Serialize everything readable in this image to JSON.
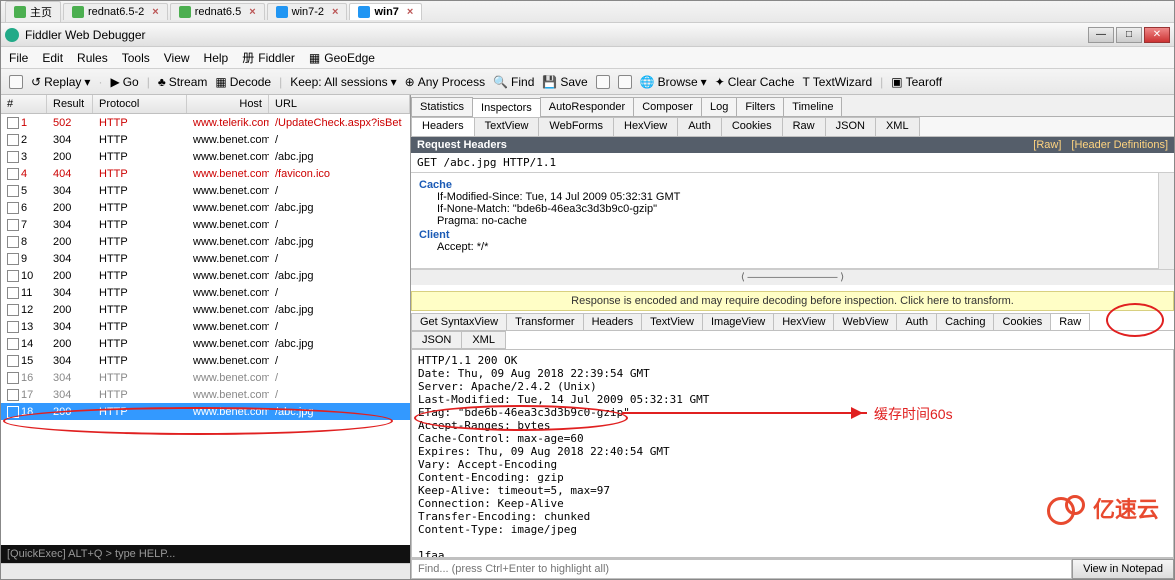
{
  "ext_tabs": [
    {
      "label": "主页",
      "icon": "home"
    },
    {
      "label": "rednat6.5-2",
      "icon": "green",
      "close": true
    },
    {
      "label": "rednat6.5",
      "icon": "green",
      "close": true
    },
    {
      "label": "win7-2",
      "icon": "blue",
      "close": true
    },
    {
      "label": "win7",
      "icon": "blue",
      "close": true,
      "active": true
    }
  ],
  "app_title": "Fiddler Web Debugger",
  "menus": [
    "File",
    "Edit",
    "Rules",
    "Tools",
    "View",
    "Help"
  ],
  "menu_fiddler": "Fiddler",
  "menu_geoedge": "GeoEdge",
  "toolbar": {
    "replay": "Replay",
    "go": "Go",
    "stream": "Stream",
    "decode": "Decode",
    "keep": "Keep: All sessions",
    "any": "Any Process",
    "find": "Find",
    "save": "Save",
    "browse": "Browse",
    "clear": "Clear Cache",
    "tw": "TextWizard",
    "tear": "Tearoff"
  },
  "cols": {
    "id": "#",
    "result": "Result",
    "protocol": "Protocol",
    "host": "Host",
    "url": "URL"
  },
  "rows": [
    {
      "n": "1",
      "res": "502",
      "proto": "HTTP",
      "host": "www.telerik.com",
      "url": "/UpdateCheck.aspx?isBet",
      "cls": "red",
      "ico": "err"
    },
    {
      "n": "2",
      "res": "304",
      "proto": "HTTP",
      "host": "www.benet.com",
      "url": "/",
      "cls": "",
      "ico": "doc"
    },
    {
      "n": "3",
      "res": "200",
      "proto": "HTTP",
      "host": "www.benet.com",
      "url": "/abc.jpg",
      "cls": "",
      "ico": "img"
    },
    {
      "n": "4",
      "res": "404",
      "proto": "HTTP",
      "host": "www.benet.com",
      "url": "/favicon.ico",
      "cls": "red",
      "ico": "warn"
    },
    {
      "n": "5",
      "res": "304",
      "proto": "HTTP",
      "host": "www.benet.com",
      "url": "/",
      "cls": "",
      "ico": "doc"
    },
    {
      "n": "6",
      "res": "200",
      "proto": "HTTP",
      "host": "www.benet.com",
      "url": "/abc.jpg",
      "cls": "",
      "ico": "img"
    },
    {
      "n": "7",
      "res": "304",
      "proto": "HTTP",
      "host": "www.benet.com",
      "url": "/",
      "cls": "",
      "ico": "doc"
    },
    {
      "n": "8",
      "res": "200",
      "proto": "HTTP",
      "host": "www.benet.com",
      "url": "/abc.jpg",
      "cls": "",
      "ico": "img"
    },
    {
      "n": "9",
      "res": "304",
      "proto": "HTTP",
      "host": "www.benet.com",
      "url": "/",
      "cls": "",
      "ico": "doc"
    },
    {
      "n": "10",
      "res": "200",
      "proto": "HTTP",
      "host": "www.benet.com",
      "url": "/abc.jpg",
      "cls": "",
      "ico": "img"
    },
    {
      "n": "11",
      "res": "304",
      "proto": "HTTP",
      "host": "www.benet.com",
      "url": "/",
      "cls": "",
      "ico": "doc"
    },
    {
      "n": "12",
      "res": "200",
      "proto": "HTTP",
      "host": "www.benet.com",
      "url": "/abc.jpg",
      "cls": "",
      "ico": "img"
    },
    {
      "n": "13",
      "res": "304",
      "proto": "HTTP",
      "host": "www.benet.com",
      "url": "/",
      "cls": "",
      "ico": "doc"
    },
    {
      "n": "14",
      "res": "200",
      "proto": "HTTP",
      "host": "www.benet.com",
      "url": "/abc.jpg",
      "cls": "",
      "ico": "img"
    },
    {
      "n": "15",
      "res": "304",
      "proto": "HTTP",
      "host": "www.benet.com",
      "url": "/",
      "cls": "",
      "ico": "doc"
    },
    {
      "n": "16",
      "res": "304",
      "proto": "HTTP",
      "host": "www.benet.com",
      "url": "/",
      "cls": "gray",
      "ico": "doc"
    },
    {
      "n": "17",
      "res": "304",
      "proto": "HTTP",
      "host": "www.benet.com",
      "url": "/",
      "cls": "gray",
      "ico": "doc"
    },
    {
      "n": "18",
      "res": "200",
      "proto": "HTTP",
      "host": "www.benet.com",
      "url": "/abc.jpg",
      "cls": "sel",
      "ico": "img"
    }
  ],
  "quickexec": "[QuickExec] ALT+Q > type HELP...",
  "rtabs1": [
    "Statistics",
    "Inspectors",
    "AutoResponder",
    "Composer",
    "Log",
    "Filters",
    "Timeline"
  ],
  "rtabs1_active": "Inspectors",
  "rtabs2": [
    "Headers",
    "TextView",
    "WebForms",
    "HexView",
    "Auth",
    "Cookies",
    "Raw",
    "JSON",
    "XML"
  ],
  "rtabs2_active": "Headers",
  "req_title": "Request Headers",
  "req_links": {
    "raw": "[Raw]",
    "defs": "[Header Definitions]"
  },
  "req_first": "GET /abc.jpg HTTP/1.1",
  "req_sections": {
    "cache_title": "Cache",
    "cache_lines": [
      "If-Modified-Since: Tue, 14 Jul 2009 05:32:31 GMT",
      "If-None-Match: \"bde6b-46ea3c3d3b9c0-gzip\"",
      "Pragma: no-cache"
    ],
    "client_title": "Client",
    "client_lines": [
      "Accept: */*"
    ]
  },
  "transform_msg": "Response is encoded and may require decoding before inspection. Click here to transform.",
  "rtabs3": [
    "Get SyntaxView",
    "Transformer",
    "Headers",
    "TextView",
    "ImageView",
    "HexView",
    "WebView",
    "Auth",
    "Caching",
    "Cookies",
    "Raw"
  ],
  "rtabs3_active": "Raw",
  "rtabs4": [
    "JSON",
    "XML"
  ],
  "raw": "HTTP/1.1 200 OK\nDate: Thu, 09 Aug 2018 22:39:54 GMT\nServer: Apache/2.4.2 (Unix)\nLast-Modified: Tue, 14 Jul 2009 05:32:31 GMT\nETag: \"bde6b-46ea3c3d3b9c0-gzip\"\nAccept-Ranges: bytes\nCache-Control: max-age=60\nExpires: Thu, 09 Aug 2018 22:40:54 GMT\nVary: Accept-Encoding\nContent-Encoding: gzip\nKeep-Alive: timeout=5, max=97\nConnection: Keep-Alive\nTransfer-Encoding: chunked\nContent-Type: image/jpeg\n\n1faa",
  "annotation": "缓存时间60s",
  "find_placeholder": "Find... (press Ctrl+Enter to highlight all)",
  "find_button": "View in Notepad",
  "watermark": "亿速云"
}
